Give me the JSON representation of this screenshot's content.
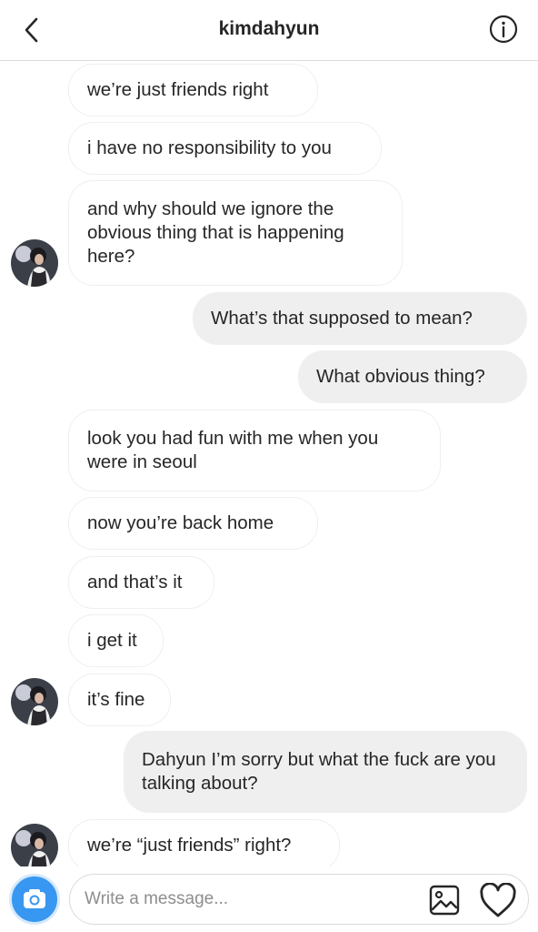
{
  "header": {
    "title": "kimdahyun"
  },
  "messages": [
    {
      "text": "we’re just friends right"
    },
    {
      "text": "i have no responsibility to you"
    },
    {
      "text": "and why should we ignore the obvious thing that is happening here?"
    },
    {
      "text": "What’s that supposed to mean?"
    },
    {
      "text": "What obvious thing?"
    },
    {
      "text": "look you had fun with me when you were in seoul"
    },
    {
      "text": "now you’re back home"
    },
    {
      "text": "and that’s it"
    },
    {
      "text": "i get it"
    },
    {
      "text": "it’s fine"
    },
    {
      "text": "Dahyun I’m sorry but what the fuck are you talking about?"
    },
    {
      "text": "we’re “just friends” right?"
    }
  ],
  "composer": {
    "placeholder": "Write a message..."
  },
  "colors": {
    "accent": "#3897f0",
    "outgoing_bubble": "#efefef",
    "border": "#dbdbdb"
  }
}
